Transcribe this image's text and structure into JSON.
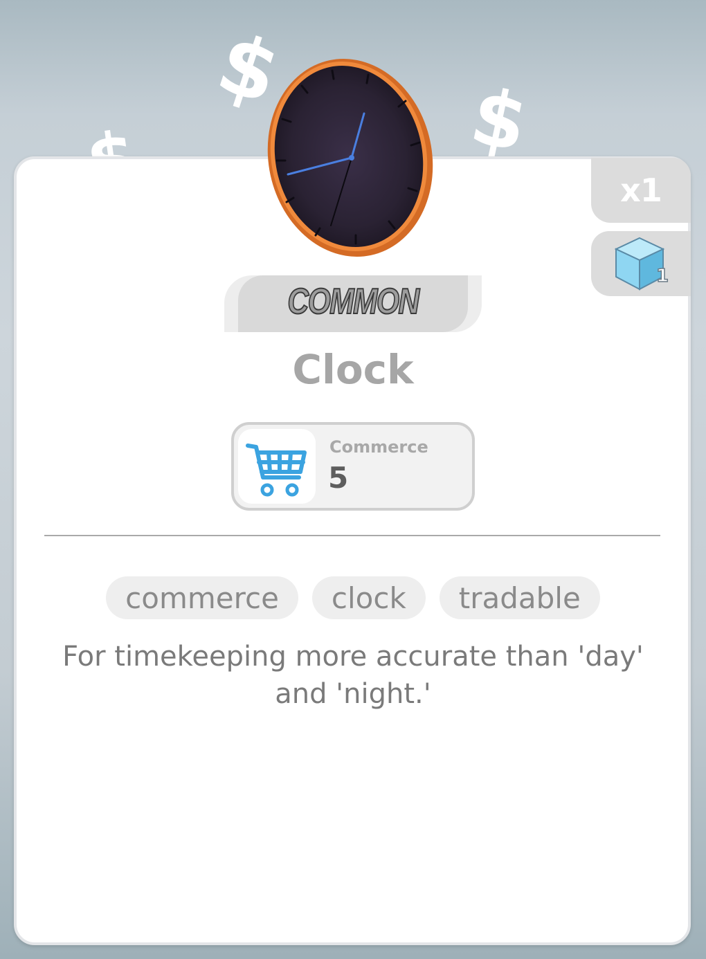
{
  "background": {
    "decor_icon": "dollar-sign",
    "decor_symbol": "$"
  },
  "item": {
    "quantity": "x1",
    "stack_count": "1",
    "rarity": "COMMON",
    "name": "Clock",
    "image_icon": "clock-icon"
  },
  "stat": {
    "icon": "shopping-cart-icon",
    "label": "Commerce",
    "value": "5"
  },
  "tags": [
    "commerce",
    "clock",
    "tradable"
  ],
  "description": "For timekeeping more accurate than 'day' and 'night.'",
  "colors": {
    "card_bg": "#ffffff",
    "badge_bg": "#dcdcdc",
    "title": "#a6a6a6",
    "cart_icon": "#3ba3e0",
    "clock_rim": "#e37a2e",
    "clock_face": "#2a2233",
    "clock_hands": "#4a7fe0",
    "cube_icon": "#8fd6f2"
  }
}
